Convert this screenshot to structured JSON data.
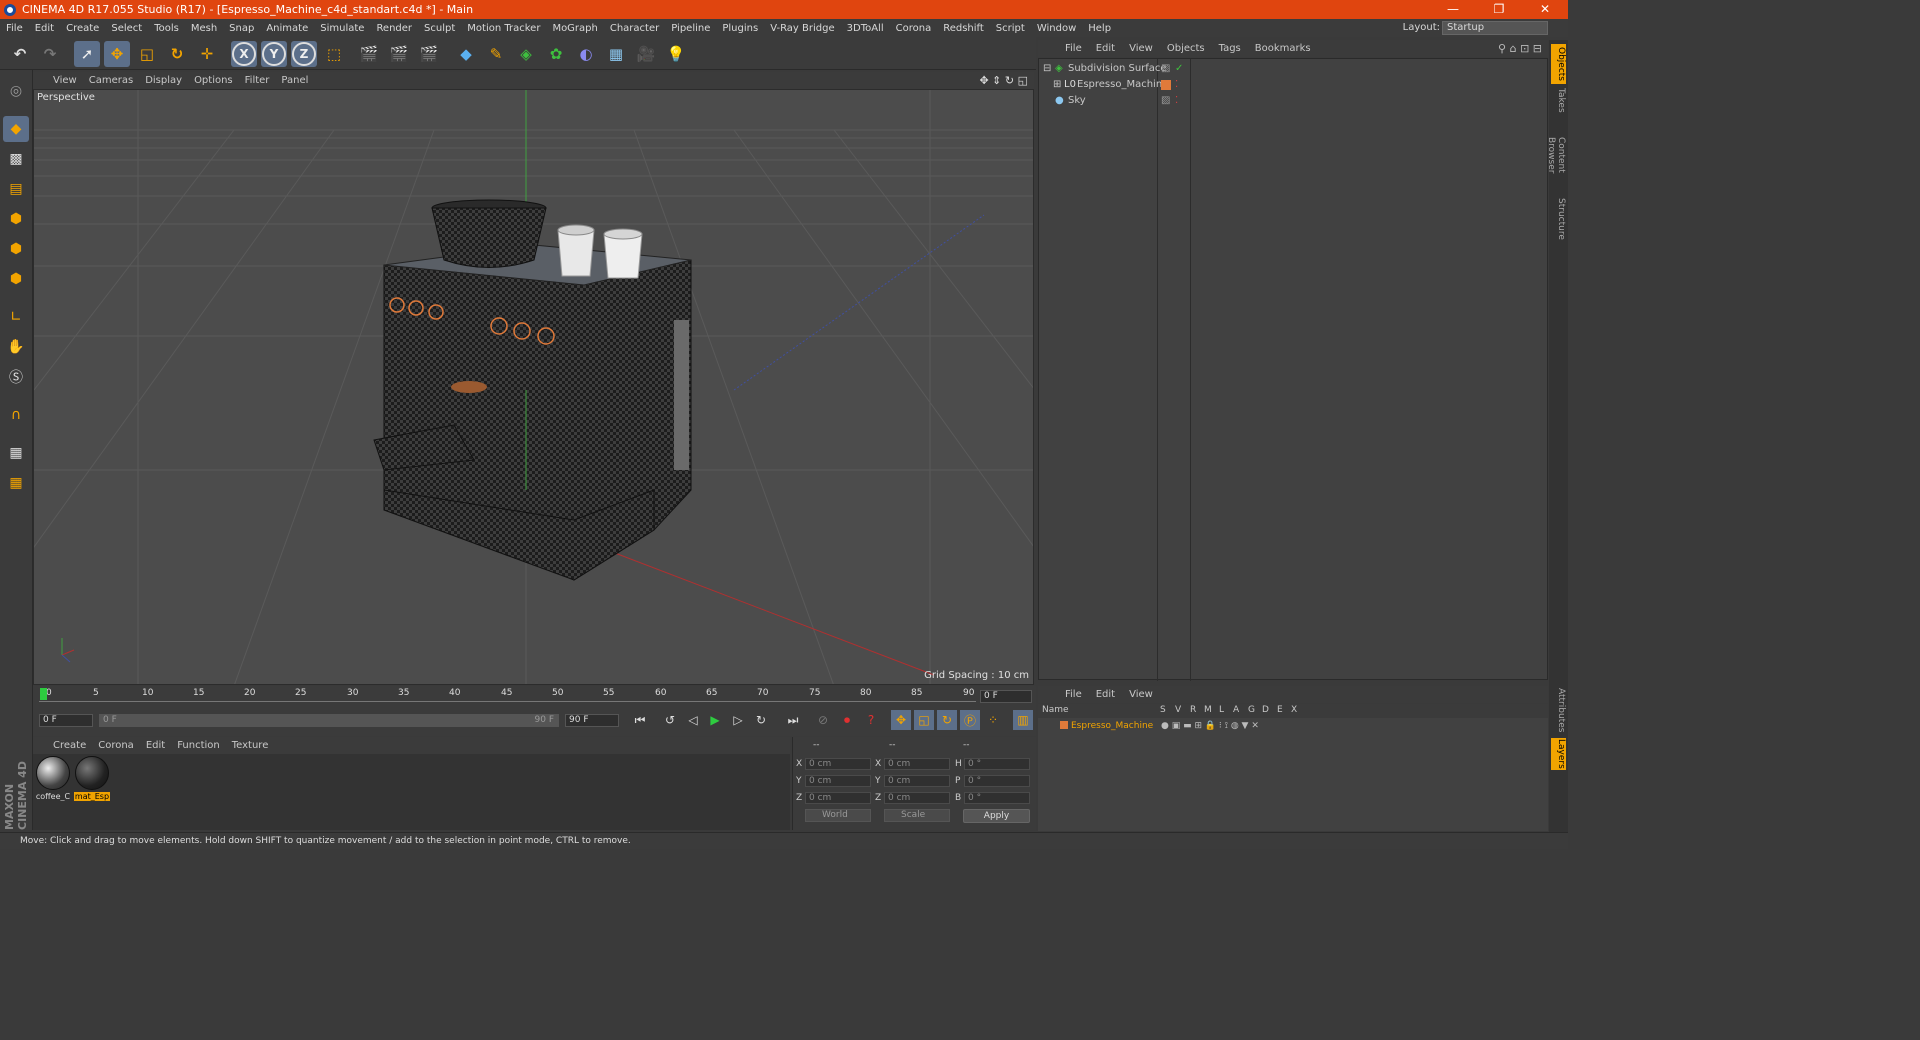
{
  "window": {
    "title": "CINEMA 4D R17.055 Studio (R17) - [Espresso_Machine_c4d_standart.c4d *] - Main",
    "controls": [
      "—",
      "❐",
      "✕"
    ]
  },
  "menubar": {
    "items": [
      "File",
      "Edit",
      "Create",
      "Select",
      "Tools",
      "Mesh",
      "Snap",
      "Animate",
      "Simulate",
      "Render",
      "Sculpt",
      "Motion Tracker",
      "MoGraph",
      "Character",
      "Pipeline",
      "Plugins",
      "V-Ray Bridge",
      "3DToAll",
      "Corona",
      "Redshift",
      "Script",
      "Window",
      "Help"
    ],
    "layout_label": "Layout:",
    "layout_value": "Startup"
  },
  "toolbar": {
    "axis_x": "X",
    "axis_y": "Y",
    "axis_z": "Z"
  },
  "viewport": {
    "menu": [
      "View",
      "Cameras",
      "Display",
      "Options",
      "Filter",
      "Panel"
    ],
    "label": "Perspective",
    "grid_spacing": "Grid Spacing : 10 cm"
  },
  "timeline": {
    "ticks": [
      "0",
      "5",
      "10",
      "15",
      "20",
      "25",
      "30",
      "35",
      "40",
      "45",
      "50",
      "55",
      "60",
      "65",
      "70",
      "75",
      "80",
      "85",
      "90"
    ],
    "current_frame": "0 F",
    "start_field": "0 F",
    "range_start": "0 F",
    "range_end": "90 F",
    "end_field": "90 F"
  },
  "material_manager": {
    "menu": [
      "Create",
      "Corona",
      "Edit",
      "Function",
      "Texture"
    ],
    "materials": [
      {
        "label": "coffee_C",
        "selected": false
      },
      {
        "label": "mat_Esp",
        "selected": true
      }
    ]
  },
  "branding": {
    "logo_text": "MAXON CINEMA 4D"
  },
  "coordinates": {
    "header": [
      "--",
      "--",
      "--"
    ],
    "rows": [
      {
        "pos_label": "X",
        "pos": "0 cm",
        "size_label": "X",
        "size": "0 cm",
        "rot_label": "H",
        "rot": "0 °"
      },
      {
        "pos_label": "Y",
        "pos": "0 cm",
        "size_label": "Y",
        "size": "0 cm",
        "rot_label": "P",
        "rot": "0 °"
      },
      {
        "pos_label": "Z",
        "pos": "0 cm",
        "size_label": "Z",
        "size": "0 cm",
        "rot_label": "B",
        "rot": "0 °"
      }
    ],
    "mode": "World",
    "size_mode": "Scale",
    "apply_label": "Apply"
  },
  "object_manager": {
    "menu": [
      "File",
      "Edit",
      "View",
      "Objects",
      "Tags",
      "Bookmarks"
    ],
    "objects": [
      {
        "name": "Subdivision Surface",
        "indent": 0
      },
      {
        "name": "Espresso_Machine",
        "indent": 1
      },
      {
        "name": "Sky",
        "indent": 0
      }
    ]
  },
  "layer_manager": {
    "menu": [
      "File",
      "Edit",
      "View"
    ],
    "columns": [
      "Name",
      "S",
      "V",
      "R",
      "M",
      "L",
      "A",
      "G",
      "D",
      "E",
      "X"
    ],
    "layers": [
      {
        "name": "Espresso_Machine"
      }
    ]
  },
  "right_tabs": [
    "Objects",
    "Takes",
    "Content Browser",
    "Structure"
  ],
  "right_tabs_bottom": [
    "Attributes",
    "Layers"
  ],
  "status": "Move: Click and drag to move elements. Hold down SHIFT to quantize movement / add to the selection in point mode, CTRL to remove.",
  "colors": {
    "title_bar": "#e0450f",
    "accent": "#f2a400",
    "selection": "#5c6f8a"
  }
}
